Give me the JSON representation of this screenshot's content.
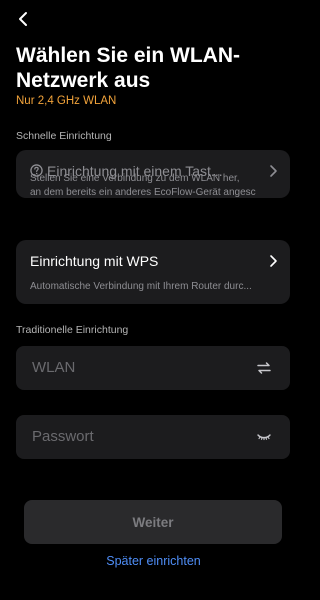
{
  "header": {
    "title": "Wählen Sie ein WLAN-Netzwerk aus",
    "subtitle": "Nur 2,4 GHz WLAN",
    "subtitle_color": "#f2a33a"
  },
  "quick_setup": {
    "section_label": "Schnelle Einrichtung",
    "one_tap_card": {
      "title": "Einrichtung mit einem Tast...",
      "description_line1": "Stellen Sie eine Verbindung zu dem WLAN her,",
      "description_line2": "an dem bereits ein anderes EcoFlow-Gerät angesc"
    },
    "wps_card": {
      "title": "Einrichtung mit WPS",
      "description": "Automatische Verbindung mit Ihrem Router durc..."
    }
  },
  "traditional_setup": {
    "section_label": "Traditionelle Einrichtung",
    "wlan_field": {
      "placeholder": "WLAN"
    },
    "password_field": {
      "placeholder": "Passwort"
    }
  },
  "actions": {
    "continue_label": "Weiter",
    "later_label": "Später einrichten",
    "link_color": "#4f8ef7"
  },
  "icons": {
    "back": "chevron-left-icon",
    "help": "question-circle-icon",
    "chevron": "chevron-right-icon",
    "switch": "swap-arrows-icon",
    "password_visibility": "eye-closed-icon"
  }
}
